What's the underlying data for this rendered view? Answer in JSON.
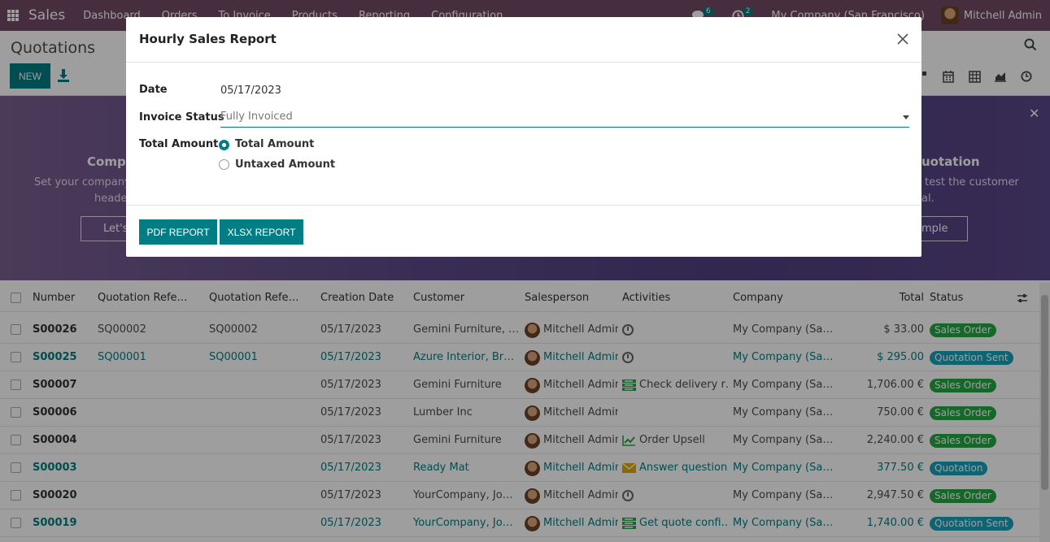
{
  "nav": {
    "brand": "Sales",
    "menu": [
      "Dashboard",
      "Orders",
      "To Invoice",
      "Products",
      "Reporting",
      "Configuration"
    ],
    "messages_count": "6",
    "activities_count": "2",
    "company": "My Company (San Francisco)",
    "user": "Mitchell Admin"
  },
  "control": {
    "title": "Quotations",
    "new_label": "NEW"
  },
  "banner": {
    "left_title": "Compa",
    "left_text_1": "Set your company's",
    "left_text_2": "header",
    "left_button": "Let's",
    "right_title": "uotation",
    "right_text_1": "test the customer",
    "right_text_2": "al.",
    "right_button": "ample"
  },
  "table": {
    "headers": {
      "number": "Number",
      "ref1": "Quotation Refe…",
      "ref2": "Quotation Refe…",
      "date": "Creation Date",
      "customer": "Customer",
      "salesperson": "Salesperson",
      "activities": "Activities",
      "company": "Company",
      "total": "Total",
      "status": "Status"
    },
    "rows": [
      {
        "number": "S00026",
        "ref1": "SQ00002",
        "ref2": "SQ00002",
        "date": "05/17/2023",
        "customer": "Gemini Furniture, S…",
        "salesperson": "Mitchell Admin",
        "activity": "",
        "company": "My Company (San F…",
        "total": "$ 33.00",
        "status": "Sales Order"
      },
      {
        "number": "S00025",
        "ref1": "SQ00001",
        "ref2": "SQ00001",
        "date": "05/17/2023",
        "customer": "Azure Interior, Bran…",
        "salesperson": "Mitchell Admin",
        "activity": "",
        "company": "My Company (San F…",
        "total": "$ 295.00",
        "status": "Quotation Sent"
      },
      {
        "number": "S00007",
        "ref1": "",
        "ref2": "",
        "date": "05/17/2023",
        "customer": "Gemini Furniture",
        "salesperson": "Mitchell Admin",
        "activity": "Check delivery r…",
        "company": "My Company (San F…",
        "total": "1,706.00 €",
        "status": "Sales Order"
      },
      {
        "number": "S00006",
        "ref1": "",
        "ref2": "",
        "date": "05/17/2023",
        "customer": "Lumber Inc",
        "salesperson": "Mitchell Admin",
        "activity": "",
        "company": "My Company (San F…",
        "total": "750.00 €",
        "status": "Sales Order"
      },
      {
        "number": "S00004",
        "ref1": "",
        "ref2": "",
        "date": "05/17/2023",
        "customer": "Gemini Furniture",
        "salesperson": "Mitchell Admin",
        "activity": "Order Upsell",
        "company": "My Company (San F…",
        "total": "2,240.00 €",
        "status": "Sales Order"
      },
      {
        "number": "S00003",
        "ref1": "",
        "ref2": "",
        "date": "05/17/2023",
        "customer": "Ready Mat",
        "salesperson": "Mitchell Admin",
        "activity": "Answer questions",
        "company": "My Company (San F…",
        "total": "377.50 €",
        "status": "Quotation"
      },
      {
        "number": "S00020",
        "ref1": "",
        "ref2": "",
        "date": "05/17/2023",
        "customer": "YourCompany, Joel …",
        "salesperson": "Mitchell Admin",
        "activity": "",
        "company": "My Company (San F…",
        "total": "2,947.50 €",
        "status": "Sales Order"
      },
      {
        "number": "S00019",
        "ref1": "",
        "ref2": "",
        "date": "05/17/2023",
        "customer": "YourCompany, Joel …",
        "salesperson": "Mitchell Admin",
        "activity": "Get quote confi…",
        "company": "My Company (San F…",
        "total": "1,740.00 €",
        "status": "Quotation Sent"
      }
    ]
  },
  "dialog": {
    "title": "Hourly Sales Report",
    "date_label": "Date",
    "date_value": "05/17/2023",
    "invoice_status_label": "Invoice Status",
    "invoice_status_value": "Fully Invoiced",
    "total_amount_label": "Total Amount",
    "radio_total": "Total Amount",
    "radio_untaxed": "Untaxed Amount",
    "pdf_button": "PDF REPORT",
    "xlsx_button": "XLSX REPORT"
  },
  "colors": {
    "brand": "#714b67",
    "primary": "#017e84",
    "badge_green": "#28a745",
    "badge_teal": "#17a2b8"
  }
}
